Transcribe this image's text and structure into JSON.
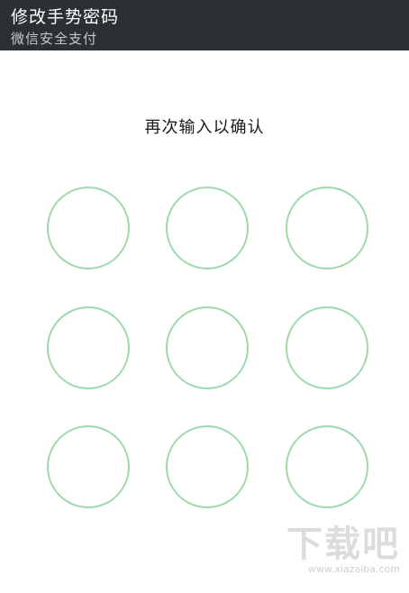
{
  "header": {
    "title": "修改手势密码",
    "subtitle": "微信安全支付"
  },
  "prompt": {
    "text": "再次输入以确认"
  },
  "pattern_dots": [
    {
      "name": "dot-1"
    },
    {
      "name": "dot-2"
    },
    {
      "name": "dot-3"
    },
    {
      "name": "dot-4"
    },
    {
      "name": "dot-5"
    },
    {
      "name": "dot-6"
    },
    {
      "name": "dot-7"
    },
    {
      "name": "dot-8"
    },
    {
      "name": "dot-9"
    }
  ],
  "watermark": {
    "logo": "下载吧",
    "url": "www.xiazaiba.com"
  },
  "colors": {
    "header_bg": "#2b3033",
    "dot_stroke": "#9ed9ad"
  }
}
